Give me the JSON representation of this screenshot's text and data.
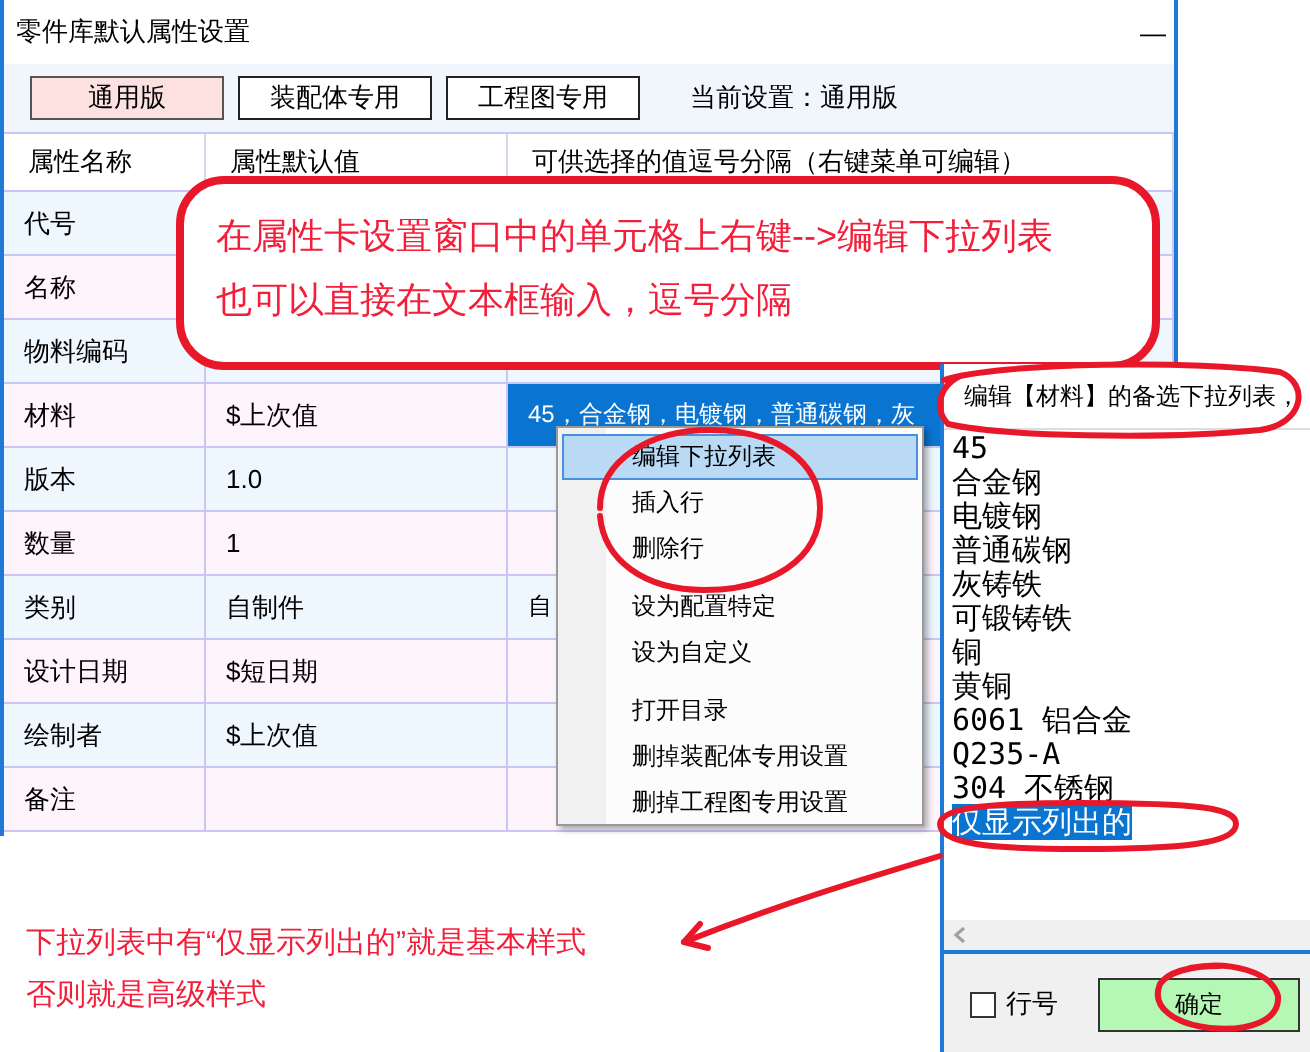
{
  "window": {
    "title": "零件库默认属性设置",
    "minimize": "—"
  },
  "presets": [
    {
      "label": "通用版",
      "selected": true
    },
    {
      "label": "装配体专用",
      "selected": false
    },
    {
      "label": "工程图专用",
      "selected": false
    }
  ],
  "current_setting": "当前设置：通用版",
  "table": {
    "columns": [
      "属性名称",
      "属性默认值",
      "可供选择的值逗号分隔（右键菜单可编辑）"
    ],
    "rows": [
      {
        "name": "代号",
        "selected": false
      },
      {
        "name": "名称",
        "selected": false
      },
      {
        "name": "物料编码",
        "selected": false
      },
      {
        "name": "材料",
        "default": "$上次值",
        "options": "45，合金钢，电镀钢，普通碳钢，灰",
        "selected": true
      },
      {
        "name": "版本",
        "default": "1.0",
        "selected": false
      },
      {
        "name": "数量",
        "default": "1",
        "selected": false
      },
      {
        "name": "类别",
        "default": "自制件",
        "options": "自",
        "selected": false
      },
      {
        "name": "设计日期",
        "default": "$短日期",
        "selected": false
      },
      {
        "name": "绘制者",
        "default": "$上次值",
        "selected": false
      },
      {
        "name": "备注",
        "selected": false
      }
    ]
  },
  "context_menu": [
    {
      "kind": "item",
      "label": "编辑下拉列表",
      "selected": true
    },
    {
      "kind": "item",
      "label": "插入行",
      "selected": false
    },
    {
      "kind": "item",
      "label": "删除行",
      "selected": false
    },
    {
      "kind": "separator"
    },
    {
      "kind": "item",
      "label": "设为配置特定",
      "selected": false
    },
    {
      "kind": "item",
      "label": "设为自定义",
      "selected": false
    },
    {
      "kind": "separator"
    },
    {
      "kind": "item",
      "label": "打开目录",
      "selected": false
    },
    {
      "kind": "item",
      "label": "删掉装配体专用设置",
      "selected": false
    },
    {
      "kind": "item",
      "label": "删掉工程图专用设置",
      "selected": false
    }
  ],
  "list_editor": {
    "header": "编辑【材料】的备选下拉列表，",
    "lines": [
      {
        "text": "45",
        "selected": false
      },
      {
        "text": "合金钢",
        "selected": false
      },
      {
        "text": "电镀钢",
        "selected": false
      },
      {
        "text": "普通碳钢",
        "selected": false
      },
      {
        "text": "灰铸铁",
        "selected": false
      },
      {
        "text": "可锻铸铁",
        "selected": false
      },
      {
        "text": "铜",
        "selected": false
      },
      {
        "text": "黄铜",
        "selected": false
      },
      {
        "text": "6061 铝合金",
        "selected": false
      },
      {
        "text": "Q235-A",
        "selected": false
      },
      {
        "text": "304 不锈钢",
        "selected": false
      },
      {
        "text": "仅显示列出的",
        "selected": true
      }
    ],
    "line_numbers": {
      "label": "行号",
      "checked": false
    },
    "ok_button": "确定"
  },
  "callout": [
    "在属性卡设置窗口中的单元格上右键-->编辑下拉列表",
    "也可以直接在文本框输入，逗号分隔"
  ],
  "note": [
    "下拉列表中有“仅显示列出的”就是基本样式",
    "否则就是高级样式"
  ]
}
